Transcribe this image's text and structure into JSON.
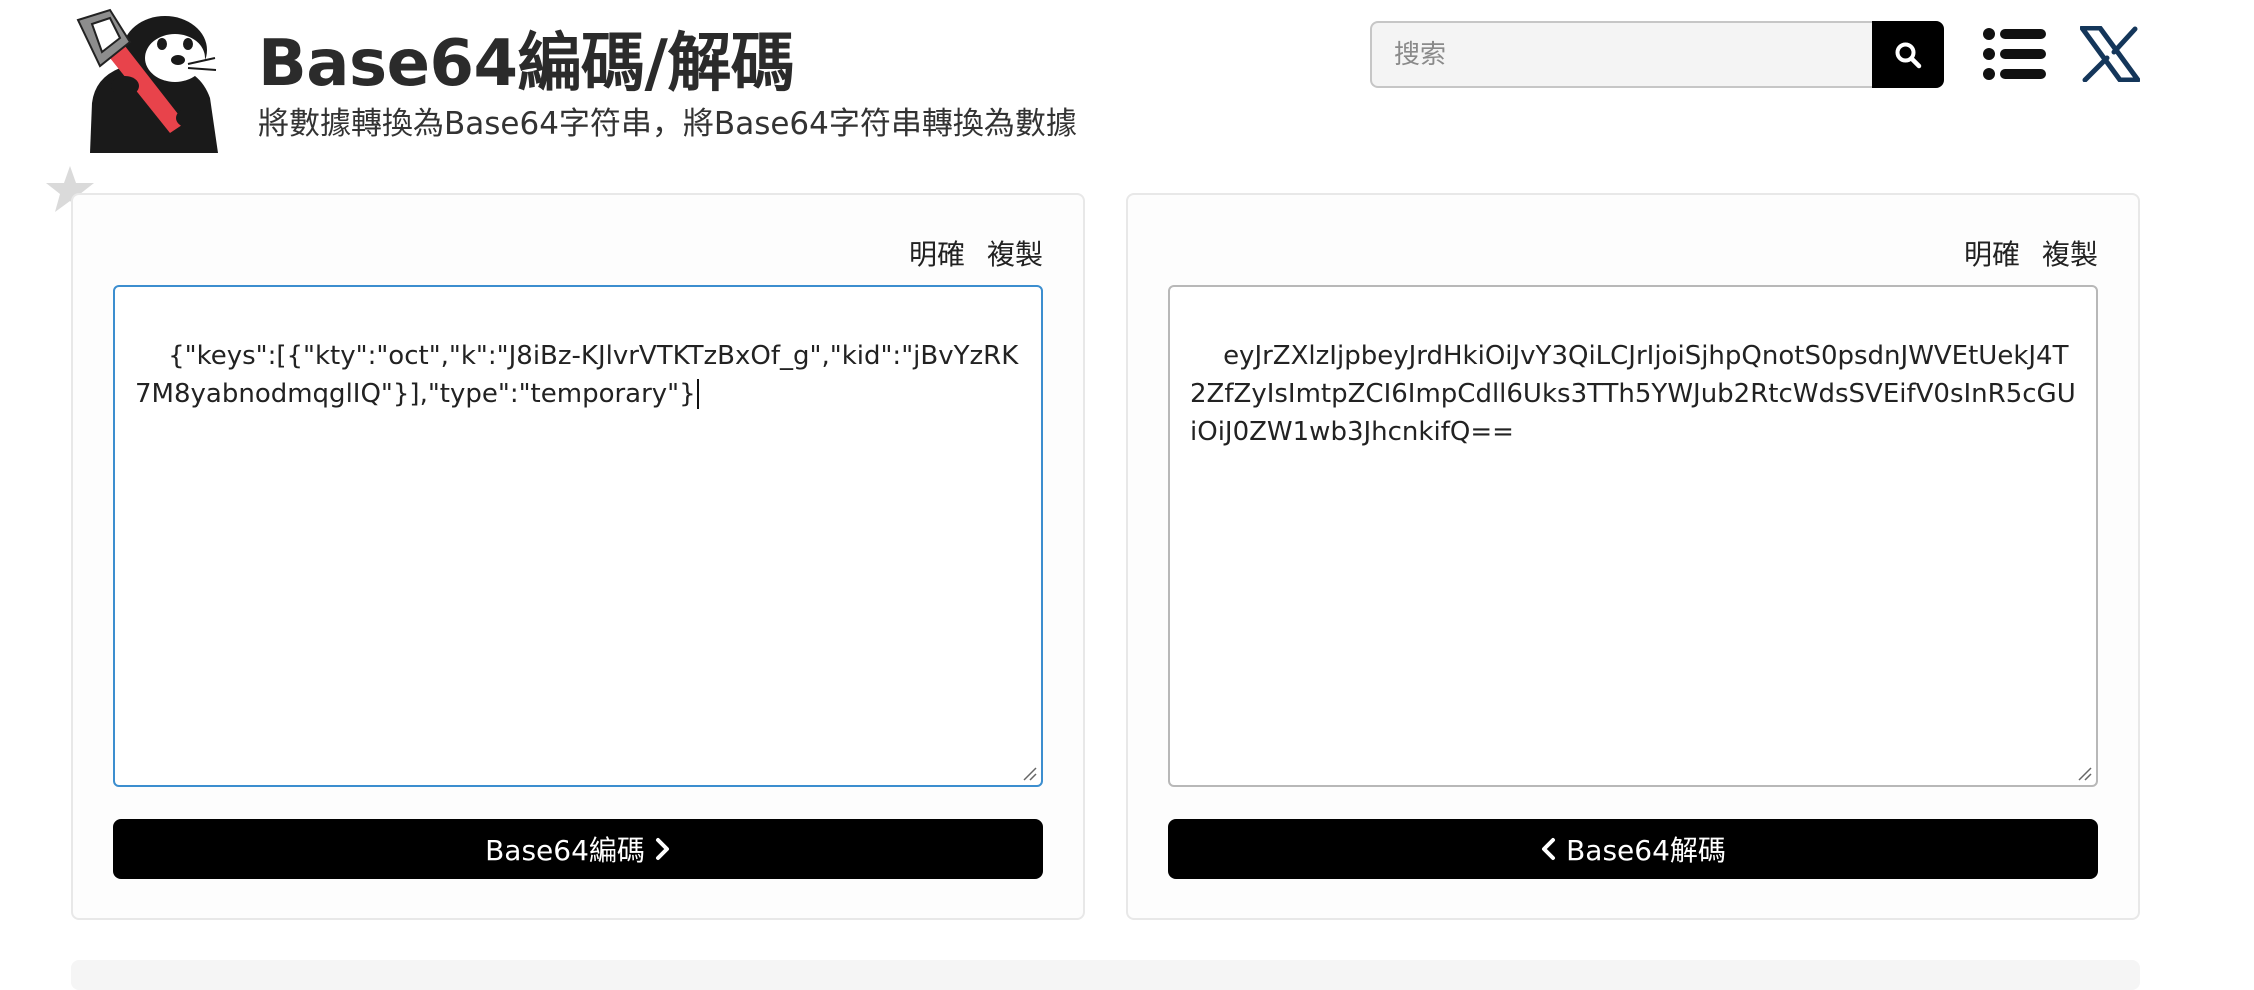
{
  "header": {
    "title": "Base64編碼/解碼",
    "subtitle": "將數據轉換為Base64字符串，將Base64字符串轉換為數據"
  },
  "search": {
    "placeholder": "搜索",
    "value": ""
  },
  "left_panel": {
    "clear_label": "明確",
    "copy_label": "複製",
    "input_value": "{\"keys\":[{\"kty\":\"oct\",\"k\":\"J8iBz-KJlvrVTKTzBxOf_g\",\"kid\":\"jBvYzRK7M8yabnodmqglIQ\"}],\"type\":\"temporary\"}",
    "button_label": "Base64編碼"
  },
  "right_panel": {
    "clear_label": "明確",
    "copy_label": "複製",
    "output_value": "eyJrZXlzIjpbeyJrdHkiOiJvY3QiLCJrIjoiSjhpQnotS0psdnJWVEtUekJ4T2ZfZyIsImtpZCI6ImpCdll6Uks3TTh5YWJub2RtcWdsSVEifV0sInR5cGUiOiJ0ZW1wb3JhcnkifQ==",
    "button_label": "Base64解碼"
  },
  "colors": {
    "accent_focus": "#3c8ecf",
    "button_bg": "#000000",
    "logo_red": "#e8434b"
  },
  "icons": [
    "search-icon",
    "list-menu-icon",
    "x-logo-icon",
    "star-icon",
    "chevron-right-icon",
    "chevron-left-icon"
  ]
}
